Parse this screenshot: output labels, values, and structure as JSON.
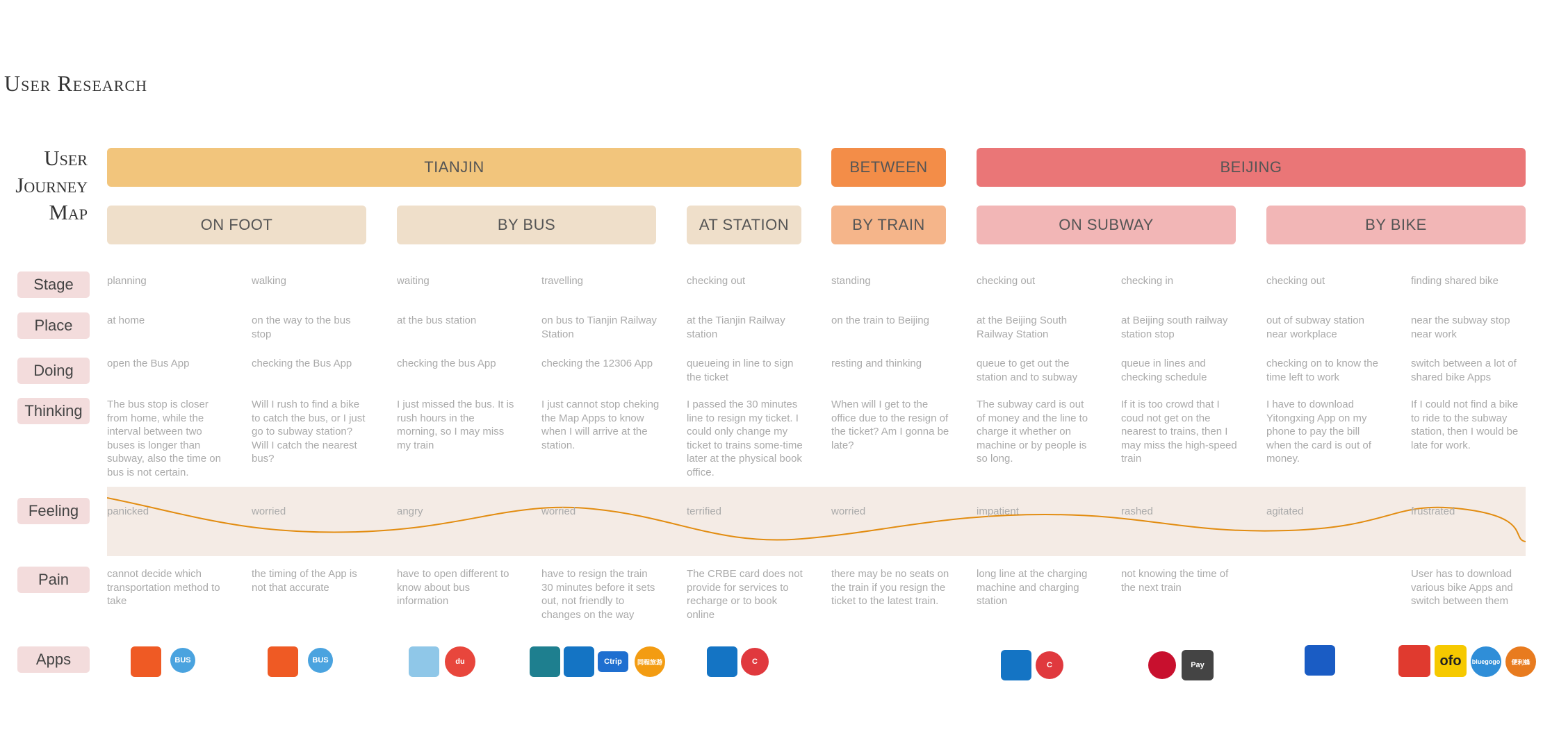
{
  "title": "User Research",
  "journey_label": [
    "User",
    "Journey",
    "Map"
  ],
  "locations": [
    {
      "label": "TIANJIN",
      "color": "#f2c57c"
    },
    {
      "label": "BETWEEN",
      "color": "#f38d48"
    },
    {
      "label": "BEIJING",
      "color": "#ea7677"
    }
  ],
  "modes": [
    {
      "label": "ON FOOT",
      "color": "#efdfca"
    },
    {
      "label": "BY BUS",
      "color": "#efdfca"
    },
    {
      "label": "AT STATION",
      "color": "#efdfca"
    },
    {
      "label": "BY TRAIN",
      "color": "#f5b58a"
    },
    {
      "label": "ON SUBWAY",
      "color": "#f2b6b6"
    },
    {
      "label": "BY BIKE",
      "color": "#f2b6b6"
    }
  ],
  "row_labels": {
    "stage": "Stage",
    "place": "Place",
    "doing": "Doing",
    "thinking": "Thinking",
    "feeling": "Feeling",
    "pain": "Pain",
    "apps": "Apps"
  },
  "stage": [
    "planning",
    "walking",
    "waiting",
    "travelling",
    "checking out",
    "standing",
    "checking out",
    "checking in",
    "checking out",
    "finding shared bike"
  ],
  "place": [
    "at home",
    "on the way to the bus stop",
    "at the bus station",
    "on bus to Tianjin Railway Station",
    "at the Tianjin Railway station",
    "on the train to Beijing",
    "at the Beijing South Railway Station",
    "at Beijing south railway station stop",
    "out of subway station near workplace",
    "near the subway stop near work"
  ],
  "doing": [
    "open the Bus App",
    "checking the Bus App",
    "checking the bus App",
    "checking the 12306 App",
    "queueing in line to sign the ticket",
    "resting and thinking",
    "queue to get out the station and to subway",
    "queue in lines and checking schedule",
    "checking on to know the time left to work",
    "switch between a lot of shared bike Apps"
  ],
  "thinking": [
    "The bus stop is closer from home, while the interval between two buses is longer than subway, also the time on bus is not certain.",
    "Will I rush to find a bike to catch the bus, or I just go to subway station? Will I catch the nearest bus?",
    "I just missed the bus. It is rush hours in the morning, so I may miss my train",
    "I just cannot stop cheking the Map Apps to  know when I will arrive at the station.",
    "I passed the 30 minutes line to resign my ticket. I could only change my ticket to trains some-time later at the physical book office.",
    "When will I get to the office due to the resign of the ticket? Am I gonna be late?",
    "The subway card is out of money and the line to charge it whether on machine or by people is so long.",
    "If it is too crowd that I coud not get on the nearest to trains, then I may miss the high-speed train",
    "I have to download Yitongxing App on my phone to pay the bill when the card is out of money.",
    "If I could not find a bike to ride to the subway station, then I would be late for work."
  ],
  "feeling": [
    "panicked",
    "worried",
    "angry",
    "worried",
    "terrified",
    "worried",
    "impatient",
    "rashed",
    "agitated",
    "frustrated"
  ],
  "pain": [
    "cannot decide which transportation method to take",
    "the timing of the App is not that accurate",
    "have to open different to know about bus information",
    "have to resign the train 30 minutes before it sets out, not friendly to changes on the way",
    "The CRBE card does not provide for services to recharge or to book online",
    "there may be no seats on the train if you resign the ticket to the latest train.",
    "long line at the charging machine and charging station",
    "not knowing the time of the next train",
    "",
    "User has to download various bike Apps and switch between them"
  ],
  "colors": {
    "feeling_curve": "#e28c10",
    "feeling_band": "#f4ebe5"
  },
  "apps": [
    {
      "name": "bus-app-icon",
      "text": ""
    },
    {
      "name": "bus-pin-icon",
      "text": "BUS"
    },
    {
      "name": "bus-app-icon",
      "text": ""
    },
    {
      "name": "bus-pin-icon",
      "text": "BUS"
    },
    {
      "name": "map-app-icon",
      "text": ""
    },
    {
      "name": "baidu-map-icon",
      "text": "du"
    },
    {
      "name": "camel-app-icon",
      "text": ""
    },
    {
      "name": "china-railway-icon",
      "text": ""
    },
    {
      "name": "ctrip-app-icon",
      "text": "Ctrip"
    },
    {
      "name": "tongcheng-app-icon",
      "text": "同程旅游"
    },
    {
      "name": "china-railway-icon",
      "text": ""
    },
    {
      "name": "c-card-icon",
      "text": "C"
    },
    {
      "name": "china-railway-icon",
      "text": ""
    },
    {
      "name": "c-card-icon",
      "text": "C"
    },
    {
      "name": "unionpay-icon",
      "text": ""
    },
    {
      "name": "apple-pay-icon",
      "text": "Pay"
    },
    {
      "name": "yitongxing-icon",
      "text": ""
    },
    {
      "name": "mobike-icon",
      "text": ""
    },
    {
      "name": "ofo-icon",
      "text": "ofo"
    },
    {
      "name": "bluegogo-icon",
      "text": "bluegogo"
    },
    {
      "name": "youon-bike-icon",
      "text": "便利蜂"
    }
  ]
}
